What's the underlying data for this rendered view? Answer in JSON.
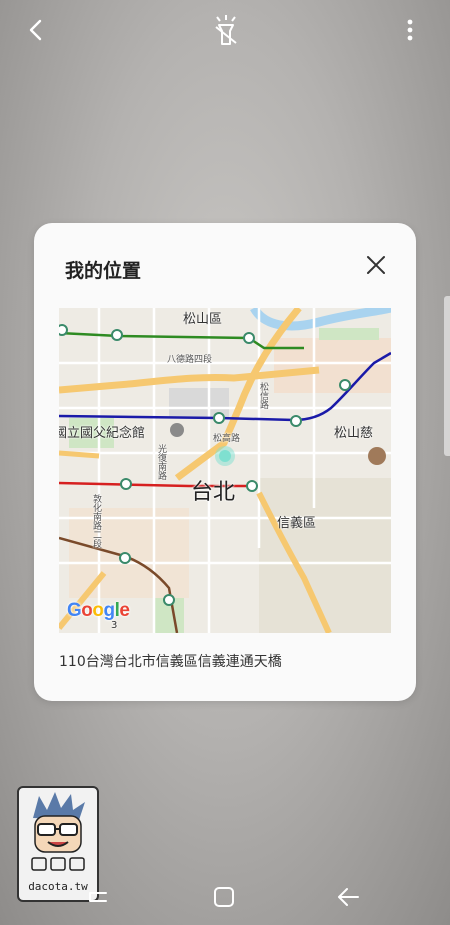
{
  "dialog": {
    "title": "我的位置",
    "address": "110台灣台北市信義區信義連通天橋"
  },
  "map": {
    "labels": {
      "songshan_district": "松山區",
      "bade_road": "八德路四段",
      "memorial_hall": "國立國父紀念館",
      "songshan_ci": "松山慈",
      "songgao_road": "松高路",
      "taipei": "台北",
      "xinyi_district": "信義區",
      "songxin_road": "松信路",
      "guangfu_south_road": "光復南路",
      "dunhua_south_road": "敦化南路二段",
      "metro_exit": "3",
      "google": "Google"
    }
  },
  "watermark": {
    "text": "dacota.tw"
  },
  "icons": {
    "back": "back-arrow-icon",
    "flash": "flashlight-off-icon",
    "more": "more-vertical-icon",
    "close": "close-icon",
    "recents": "recents-icon",
    "home": "home-icon",
    "back_nav": "back-nav-icon"
  },
  "colors": {
    "green_line": "#2e8b22",
    "blue_line": "#1a1aa8",
    "red_line": "#d62020",
    "brown_line": "#7a4a2a",
    "highway": "#f6c870",
    "location_dot": "#7fe0d0"
  }
}
